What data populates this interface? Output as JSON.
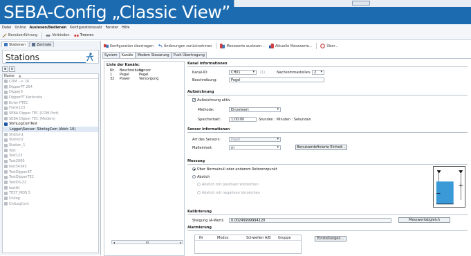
{
  "banner": {
    "title": "SEBA-Config „Classic View”"
  },
  "menu": [
    "Datei",
    "Online",
    "Auslesen/Bedienen",
    "Konfigurationssatz",
    "Fenster",
    "Hilfe"
  ],
  "toolbar": {
    "user": "Benutzerführung",
    "connect": "Verbinden",
    "disconnect": "Trennen"
  },
  "left_tabs": {
    "stations": "Stationen",
    "central": "Zentrale"
  },
  "stations_title": "Stations",
  "list_header": "Name",
  "stations": [
    {
      "label": "COM --> 16"
    },
    {
      "label": "DipperPT 254"
    },
    {
      "label": "Dipper3"
    },
    {
      "label": "DipperPT Karlsruhe"
    },
    {
      "label": "Enter PTEC"
    },
    {
      "label": "Frank123"
    },
    {
      "label": "SEBA Dipper TEC (COM-Port)"
    },
    {
      "label": "SEBA Dipper TEC (Modem)"
    },
    {
      "label": "SlimLogComTest"
    },
    {
      "label": "Logger\\Sensor: SlimlogCom (Addr. 16)"
    },
    {
      "label": "Station1"
    },
    {
      "label": "Station2"
    },
    {
      "label": "Station_1"
    },
    {
      "label": "Test"
    },
    {
      "label": "Test123"
    },
    {
      "label": "Test2000"
    },
    {
      "label": "test34343"
    },
    {
      "label": "TestDipper3T"
    },
    {
      "label": "TestDipperTEC"
    },
    {
      "label": "TestDS-22"
    },
    {
      "label": "testttt"
    },
    {
      "label": "TEST_MDS 5"
    },
    {
      "label": "Unilog"
    },
    {
      "label": "UniLogCom"
    }
  ],
  "right_toolbar": {
    "transfer": "Konfiguration übertragen",
    "undo": "Änderungen zurücknehmen",
    "read_values": "Messwerte auslesen...",
    "current_values": "Aktuelle Messwerte...",
    "info": "Über..."
  },
  "tabs": [
    "System",
    "Kanäle",
    "Modem Steuerung",
    "Push Übertragung"
  ],
  "channel_list": {
    "title": "Liste der Kanäle:",
    "headers": [
      "Nr.",
      "Beschreibung",
      "Sensor"
    ],
    "rows": [
      [
        "1",
        "Pegel",
        "Pegel"
      ],
      [
        "32",
        "Power",
        "Versorgung"
      ]
    ],
    "scroll_mid": "III"
  },
  "kanal_info": {
    "title": "Kanal informationen",
    "kanal_id_label": "Kanal-ID:",
    "kanal_id_value": "CH01",
    "kanal_id_note": "(1)",
    "decimals_label": "Nachkommastellen:",
    "decimals_value": "2",
    "desc_label": "Beschreibung:",
    "desc_value": "Pegel"
  },
  "recording": {
    "title": "Aufzeichnung",
    "active_label": "Aufzeichnung aktiv",
    "method_label": "Methode:",
    "method_value": "Einzelwert",
    "interval_label": "Speichertakt:",
    "interval_value": "1:00:00",
    "interval_unit": "Stunden : Minuten : Sekunden"
  },
  "sensor_info": {
    "title": "Sensor informationen",
    "type_label": "Art des Sensors:",
    "type_value": "Pegel",
    "unit_label": "Maßeinheit:",
    "unit_value": "m",
    "custom_unit_button": "Benutzerdefinierte Einheit..."
  },
  "measurement": {
    "title": "Messung",
    "option_above": "Über Normalnull oder anderem Referenzpunkt",
    "option_depth": "Abstich",
    "option_pos": "Abstich mit positiven Vorzeichen",
    "option_neg": "Abstich mit negativen Vorzeichen"
  },
  "calibration": {
    "title": "Kalibrierung",
    "slope_label": "Steigung (A-Wert):",
    "slope_value": "0.00249999994120",
    "button": "Messwertabgleich"
  },
  "alarm": {
    "title": "Alarmierung",
    "headers": [
      "Nr",
      "Modus",
      "Schwellen A/B",
      "Gruppe"
    ],
    "button": "Einstellungen..."
  },
  "colors": {
    "banner": "#1c6bb0",
    "accent": "#1f57a8"
  }
}
